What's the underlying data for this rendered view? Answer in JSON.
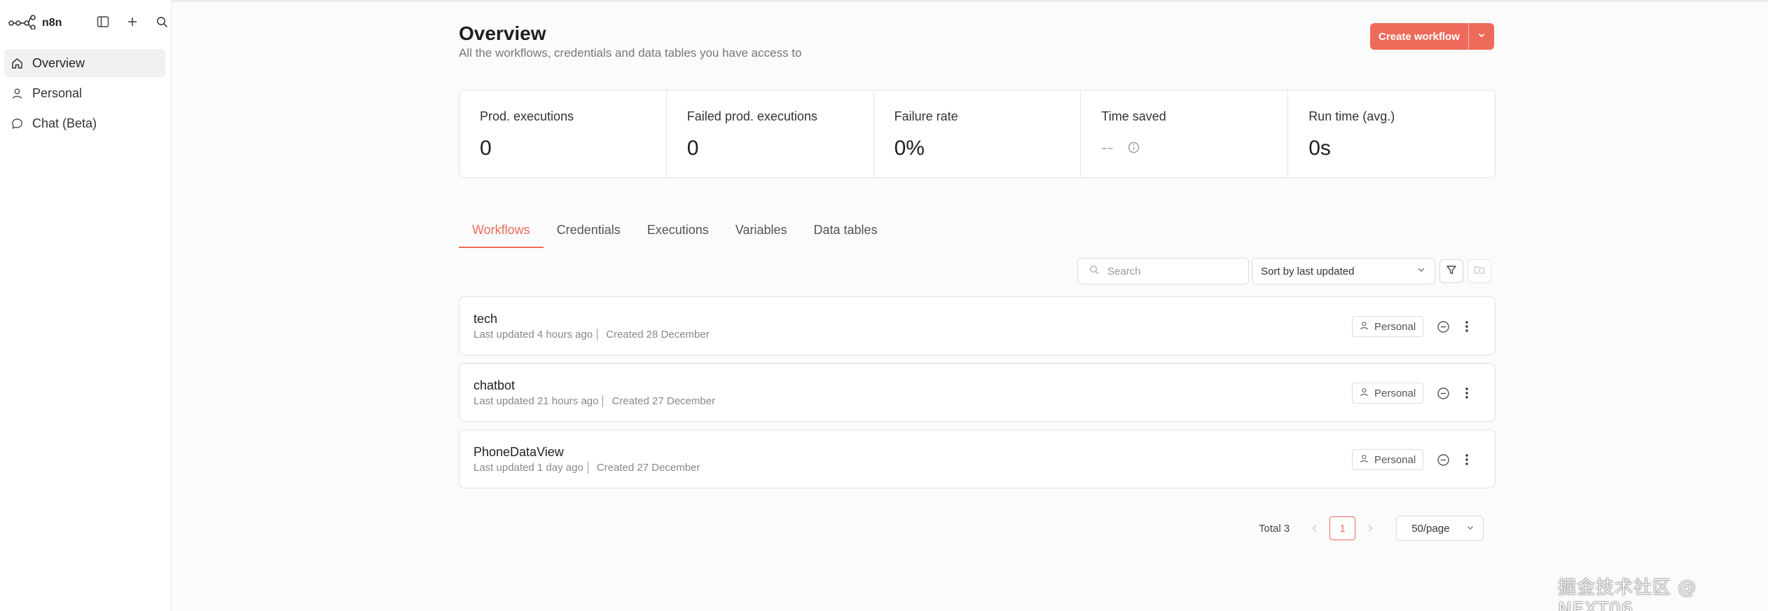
{
  "app": {
    "brand": "n8n"
  },
  "sidebar": {
    "top_icons": [
      "sidebar-toggle-icon",
      "plus-icon",
      "search-icon"
    ],
    "items": [
      {
        "label": "Overview",
        "icon": "home-icon",
        "active": true
      },
      {
        "label": "Personal",
        "icon": "user-icon",
        "active": false
      },
      {
        "label": "Chat (Beta)",
        "icon": "chat-icon",
        "active": false
      }
    ]
  },
  "header": {
    "title": "Overview",
    "subtitle": "All the workflows, credentials and data tables you have access to",
    "create_label": "Create workflow"
  },
  "stats": [
    {
      "label": "Prod. executions",
      "value": "0"
    },
    {
      "label": "Failed prod. executions",
      "value": "0"
    },
    {
      "label": "Failure rate",
      "value": "0%"
    },
    {
      "label": "Time saved",
      "value": "--"
    },
    {
      "label": "Run time (avg.)",
      "value": "0s"
    }
  ],
  "tabs": [
    {
      "label": "Workflows",
      "active": true
    },
    {
      "label": "Credentials",
      "active": false
    },
    {
      "label": "Executions",
      "active": false
    },
    {
      "label": "Variables",
      "active": false
    },
    {
      "label": "Data tables",
      "active": false
    }
  ],
  "toolbar": {
    "search_placeholder": "Search",
    "sort_label": "Sort by last updated"
  },
  "workflows": [
    {
      "name": "tech",
      "updated": "Last updated 4 hours ago",
      "created": "Created 28 December",
      "owner": "Personal"
    },
    {
      "name": "chatbot",
      "updated": "Last updated 21 hours ago",
      "created": "Created 27 December",
      "owner": "Personal"
    },
    {
      "name": "PhoneDataView",
      "updated": "Last updated 1 day ago",
      "created": "Created 27 December",
      "owner": "Personal"
    }
  ],
  "pagination": {
    "total": "Total 3",
    "current_page": "1",
    "page_size": "50/page"
  },
  "watermark": "掘金技术社区 @ NEXT06",
  "colors": {
    "accent": "#ee6b5b",
    "border": "#e2e2e2",
    "background": "#fbfbfb"
  }
}
